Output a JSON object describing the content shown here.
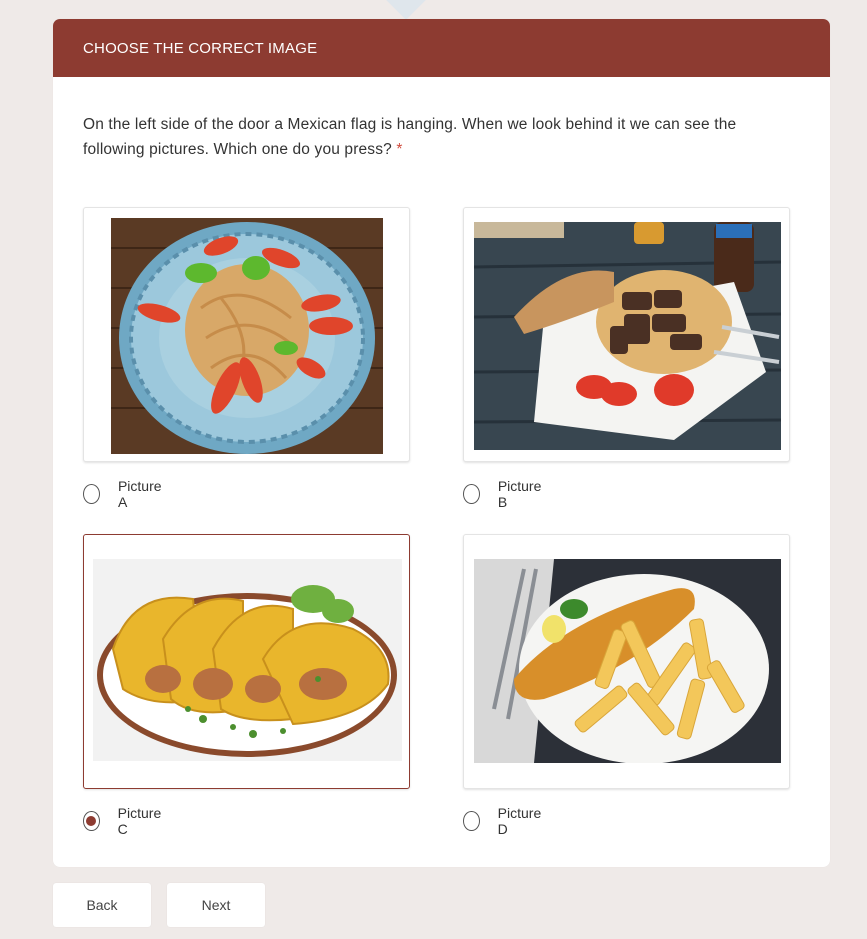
{
  "header": {
    "title": "CHOOSE THE CORRECT IMAGE"
  },
  "question": {
    "text": "On the left side of the door a Mexican flag is hanging. When we look behind it we can see the following pictures. Which one do you press?",
    "required_mark": "*"
  },
  "options": [
    {
      "label": "Picture A",
      "selected": false
    },
    {
      "label": "Picture B",
      "selected": false
    },
    {
      "label": "Picture C",
      "selected": true
    },
    {
      "label": "Picture D",
      "selected": false
    }
  ],
  "nav": {
    "back_label": "Back",
    "next_label": "Next"
  },
  "colors": {
    "accent": "#8d3b31",
    "background": "#efeae8",
    "card": "#ffffff"
  }
}
